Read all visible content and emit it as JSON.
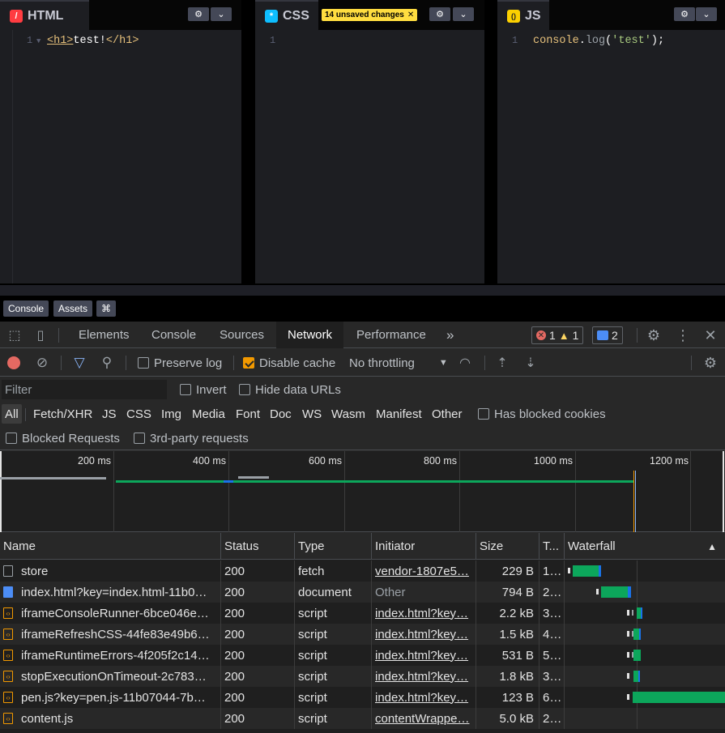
{
  "editors": {
    "html": {
      "title": "HTML",
      "icon_glyph": "/",
      "line_no": "1",
      "code": {
        "open_tag": "<h1>",
        "text": "test!",
        "close_tag": "</h1>"
      }
    },
    "css": {
      "title": "CSS",
      "icon_glyph": "*",
      "line_no": "1",
      "unsaved_label": "14 unsaved changes"
    },
    "js": {
      "title": "JS",
      "icon_glyph": "()",
      "line_no": "1",
      "code": {
        "obj": "console",
        "dot": ".",
        "fn": "log",
        "open": "(",
        "str": "'test'",
        "close": ");"
      }
    }
  },
  "codepen_footer": {
    "console": "Console",
    "assets": "Assets",
    "shortcuts": "⌘"
  },
  "devtools": {
    "tabs": [
      "Elements",
      "Console",
      "Sources",
      "Network",
      "Performance"
    ],
    "active_tab": "Network",
    "more_tabs": "»",
    "errors": "1",
    "warnings": "1",
    "messages": "2",
    "toolbar": {
      "preserve_log": "Preserve log",
      "disable_cache": "Disable cache",
      "throttling": "No throttling"
    },
    "filter": {
      "placeholder": "Filter",
      "invert": "Invert",
      "hide_data_urls": "Hide data URLs"
    },
    "types": [
      "All",
      "Fetch/XHR",
      "JS",
      "CSS",
      "Img",
      "Media",
      "Font",
      "Doc",
      "WS",
      "Wasm",
      "Manifest",
      "Other"
    ],
    "has_blocked_cookies": "Has blocked cookies",
    "blocked_requests": "Blocked Requests",
    "third_party": "3rd-party requests",
    "overview_ticks": [
      "200 ms",
      "400 ms",
      "600 ms",
      "800 ms",
      "1000 ms",
      "1200 ms"
    ],
    "columns": [
      "Name",
      "Status",
      "Type",
      "Initiator",
      "Size",
      "T...",
      "Waterfall"
    ],
    "sort_indicator": "▲",
    "rows": [
      {
        "name": "store",
        "status": "200",
        "type": "fetch",
        "initiator": "vendor-1807e5…",
        "initiator_link": true,
        "size": "229 B",
        "time": "1…",
        "icon": "plain"
      },
      {
        "name": "index.html?key=index.html-11b0…",
        "status": "200",
        "type": "document",
        "initiator": "Other",
        "initiator_link": false,
        "size": "794 B",
        "time": "2…",
        "icon": "doc"
      },
      {
        "name": "iframeConsoleRunner-6bce046e…",
        "status": "200",
        "type": "script",
        "initiator": "index.html?key…",
        "initiator_link": true,
        "size": "2.2 kB",
        "time": "3…",
        "icon": "script"
      },
      {
        "name": "iframeRefreshCSS-44fe83e49b6…",
        "status": "200",
        "type": "script",
        "initiator": "index.html?key…",
        "initiator_link": true,
        "size": "1.5 kB",
        "time": "4…",
        "icon": "script"
      },
      {
        "name": "iframeRuntimeErrors-4f205f2c14…",
        "status": "200",
        "type": "script",
        "initiator": "index.html?key…",
        "initiator_link": true,
        "size": "531 B",
        "time": "5…",
        "icon": "script"
      },
      {
        "name": "stopExecutionOnTimeout-2c783…",
        "status": "200",
        "type": "script",
        "initiator": "index.html?key…",
        "initiator_link": true,
        "size": "1.8 kB",
        "time": "3…",
        "icon": "script"
      },
      {
        "name": "pen.js?key=pen.js-11b07044-7b…",
        "status": "200",
        "type": "script",
        "initiator": "index.html?key…",
        "initiator_link": true,
        "size": "123 B",
        "time": "6…",
        "icon": "script"
      },
      {
        "name": "content.js",
        "status": "200",
        "type": "script",
        "initiator": "contentWrappe…",
        "initiator_link": true,
        "size": "5.0 kB",
        "time": "2…",
        "icon": "script"
      }
    ],
    "colors": {
      "accent_blue": "#8ab4f8",
      "waterfall_green": "#0ca65b",
      "waterfall_blue": "#1a73e8",
      "record_red": "#e46962",
      "cache_orange": "#f29900"
    }
  }
}
